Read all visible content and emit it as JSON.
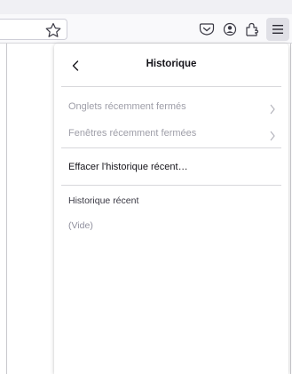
{
  "toolbar": {
    "icons": [
      "star-bookmark-icon",
      "pocket-icon",
      "account-icon",
      "extensions-icon",
      "hamburger-menu-icon"
    ]
  },
  "panel": {
    "title": "Historique",
    "back_icon": "chevron-left-icon",
    "items": [
      {
        "label": "Onglets récemment fermés",
        "enabled": false,
        "icon": "chevron-right-icon"
      },
      {
        "label": "Fenêtres récemment fermées",
        "enabled": false,
        "icon": "chevron-right-icon"
      },
      {
        "label": "Effacer l'historique récent…",
        "enabled": true
      }
    ],
    "recent_heading": "Historique récent",
    "empty_label": "(Vide)"
  },
  "colors": {
    "toolbar_bg": "#f9f9fb",
    "panel_bg": "#ffffff",
    "text_primary": "#15141a",
    "text_disabled": "#9e9ea8",
    "menu_button_active": "#e0e0e6"
  }
}
